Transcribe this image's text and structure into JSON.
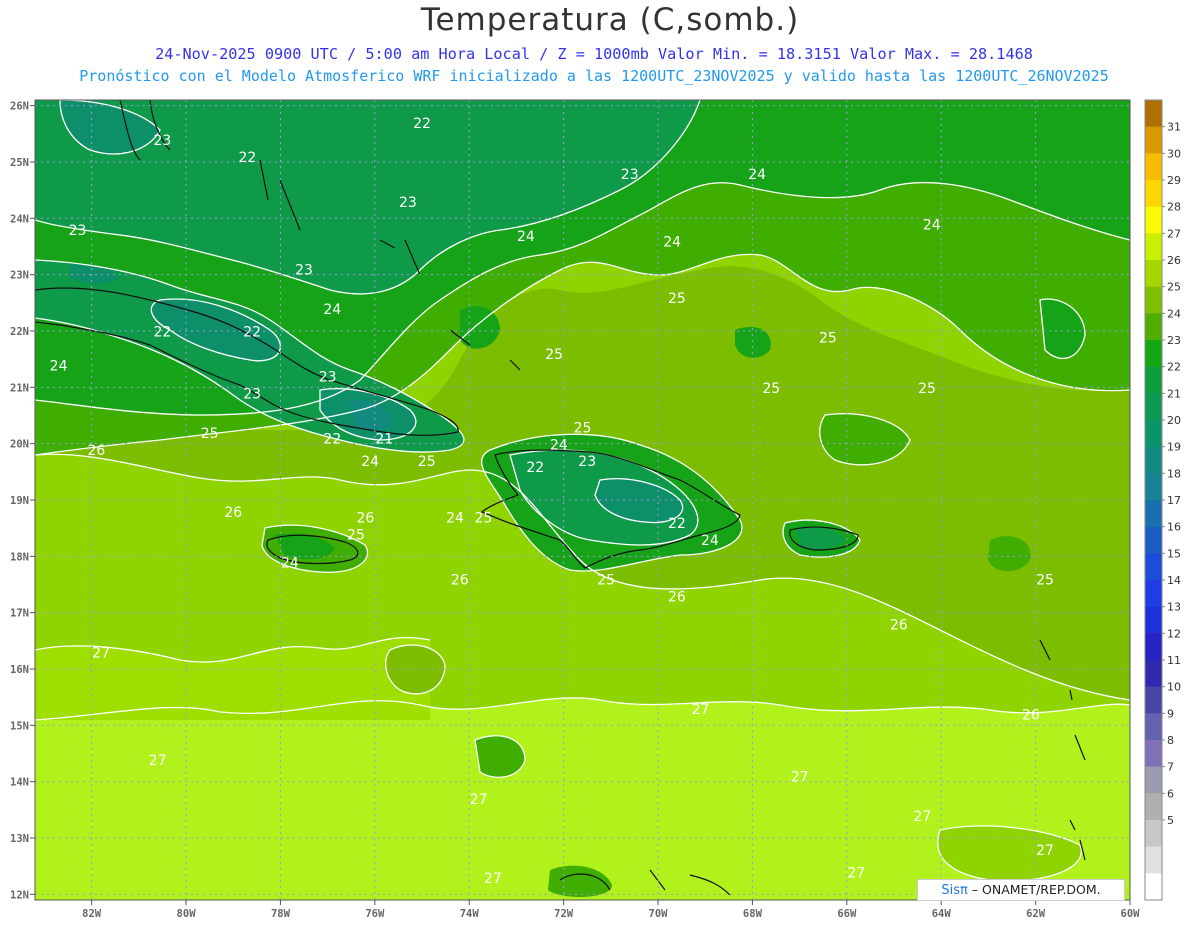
{
  "title": "Temperatura (C,somb.)",
  "subtitle1": "24-Nov-2025 0900 UTC / 5:00 am Hora Local / Z = 1000mb   Valor Min. = 18.3151  Valor Max. = 28.1468",
  "subtitle2": "Pronóstico con el Modelo Atmosferico WRF inicializado a las 1200UTC_23NOV2025 y valido hasta las  1200UTC_26NOV2025",
  "credit": {
    "brand": "Sisπ",
    "text": " – ONAMET/REP.DOM."
  },
  "map": {
    "lon_range": [
      -83.2,
      -60.0
    ],
    "lat_range": [
      11.9,
      26.1
    ],
    "lon_ticks": [
      "82W",
      "80W",
      "78W",
      "76W",
      "74W",
      "72W",
      "70W",
      "68W",
      "66W",
      "64W",
      "62W",
      "60W"
    ],
    "lat_ticks": [
      "12N",
      "13N",
      "14N",
      "15N",
      "16N",
      "17N",
      "18N",
      "19N",
      "20N",
      "21N",
      "22N",
      "23N",
      "24N",
      "25N",
      "26N"
    ],
    "contour_labels": [
      {
        "text": "22",
        "lon": -75.0,
        "lat": 25.6
      },
      {
        "text": "23",
        "lon": -80.5,
        "lat": 25.3
      },
      {
        "text": "22",
        "lon": -78.7,
        "lat": 25.0
      },
      {
        "text": "23",
        "lon": -70.6,
        "lat": 24.7
      },
      {
        "text": "24",
        "lon": -67.9,
        "lat": 24.7
      },
      {
        "text": "23",
        "lon": -75.3,
        "lat": 24.2
      },
      {
        "text": "24",
        "lon": -64.2,
        "lat": 23.8
      },
      {
        "text": "23",
        "lon": -82.3,
        "lat": 23.7
      },
      {
        "text": "24",
        "lon": -72.8,
        "lat": 23.6
      },
      {
        "text": "24",
        "lon": -69.7,
        "lat": 23.5
      },
      {
        "text": "23",
        "lon": -77.5,
        "lat": 23.0
      },
      {
        "text": "25",
        "lon": -69.6,
        "lat": 22.5
      },
      {
        "text": "24",
        "lon": -76.9,
        "lat": 22.3
      },
      {
        "text": "22",
        "lon": -80.5,
        "lat": 21.9
      },
      {
        "text": "22",
        "lon": -78.6,
        "lat": 21.9
      },
      {
        "text": "25",
        "lon": -66.4,
        "lat": 21.8
      },
      {
        "text": "25",
        "lon": -72.2,
        "lat": 21.5
      },
      {
        "text": "24",
        "lon": -82.7,
        "lat": 21.3
      },
      {
        "text": "23",
        "lon": -77.0,
        "lat": 21.1
      },
      {
        "text": "25",
        "lon": -67.6,
        "lat": 20.9
      },
      {
        "text": "25",
        "lon": -64.3,
        "lat": 20.9
      },
      {
        "text": "23",
        "lon": -78.6,
        "lat": 20.8
      },
      {
        "text": "25",
        "lon": -71.6,
        "lat": 20.2
      },
      {
        "text": "25",
        "lon": -79.5,
        "lat": 20.1
      },
      {
        "text": "24",
        "lon": -72.1,
        "lat": 19.9
      },
      {
        "text": "22",
        "lon": -76.9,
        "lat": 20.0
      },
      {
        "text": "21",
        "lon": -75.8,
        "lat": 20.0
      },
      {
        "text": "26",
        "lon": -81.9,
        "lat": 19.8
      },
      {
        "text": "23",
        "lon": -71.5,
        "lat": 19.6
      },
      {
        "text": "24",
        "lon": -76.1,
        "lat": 19.6
      },
      {
        "text": "25",
        "lon": -74.9,
        "lat": 19.6
      },
      {
        "text": "22",
        "lon": -72.6,
        "lat": 19.5
      },
      {
        "text": "26",
        "lon": -79.0,
        "lat": 18.7
      },
      {
        "text": "26",
        "lon": -76.2,
        "lat": 18.6
      },
      {
        "text": "24",
        "lon": -74.3,
        "lat": 18.6
      },
      {
        "text": "25",
        "lon": -73.7,
        "lat": 18.6
      },
      {
        "text": "22",
        "lon": -69.6,
        "lat": 18.5
      },
      {
        "text": "25",
        "lon": -76.4,
        "lat": 18.3
      },
      {
        "text": "24",
        "lon": -68.9,
        "lat": 18.2
      },
      {
        "text": "24",
        "lon": -77.8,
        "lat": 17.8
      },
      {
        "text": "26",
        "lon": -74.2,
        "lat": 17.5
      },
      {
        "text": "25",
        "lon": -71.1,
        "lat": 17.5
      },
      {
        "text": "25",
        "lon": -61.8,
        "lat": 17.5
      },
      {
        "text": "26",
        "lon": -69.6,
        "lat": 17.2
      },
      {
        "text": "26",
        "lon": -64.9,
        "lat": 16.7
      },
      {
        "text": "27",
        "lon": -81.8,
        "lat": 16.2
      },
      {
        "text": "27",
        "lon": -69.1,
        "lat": 15.2
      },
      {
        "text": "26",
        "lon": -62.1,
        "lat": 15.1
      },
      {
        "text": "27",
        "lon": -80.6,
        "lat": 14.3
      },
      {
        "text": "27",
        "lon": -67.0,
        "lat": 14.0
      },
      {
        "text": "27",
        "lon": -73.8,
        "lat": 13.6
      },
      {
        "text": "27",
        "lon": -64.4,
        "lat": 13.3
      },
      {
        "text": "27",
        "lon": -73.5,
        "lat": 12.2
      },
      {
        "text": "27",
        "lon": -65.8,
        "lat": 12.3
      },
      {
        "text": "27",
        "lon": -61.8,
        "lat": 12.7
      }
    ]
  },
  "colorbar": {
    "levels": [
      "31",
      "30",
      "29",
      "28",
      "27",
      "26",
      "25",
      "24",
      "23",
      "22",
      "21",
      "20",
      "19",
      "18",
      "17",
      "16",
      "15",
      "14",
      "13",
      "12",
      "11",
      "10",
      "9",
      "8",
      "7",
      "6",
      "5"
    ],
    "colors": [
      "#b07000",
      "#d99a00",
      "#f7be00",
      "#ffd700",
      "#fafa00",
      "#c8f000",
      "#a6d800",
      "#7fbf00",
      "#4fae00",
      "#13a813",
      "#0f9e3c",
      "#0d9a52",
      "#0b946a",
      "#128a80",
      "#1a8296",
      "#1a6fb0",
      "#1a5ec4",
      "#1a4ed8",
      "#1e3de6",
      "#2030d8",
      "#2523c4",
      "#2d2ab0",
      "#4646a8",
      "#6262b0",
      "#8070b8",
      "#9c9cb0",
      "#b0b0b0",
      "#c8c8c8",
      "#e0e0e0",
      "#ffffff"
    ]
  }
}
